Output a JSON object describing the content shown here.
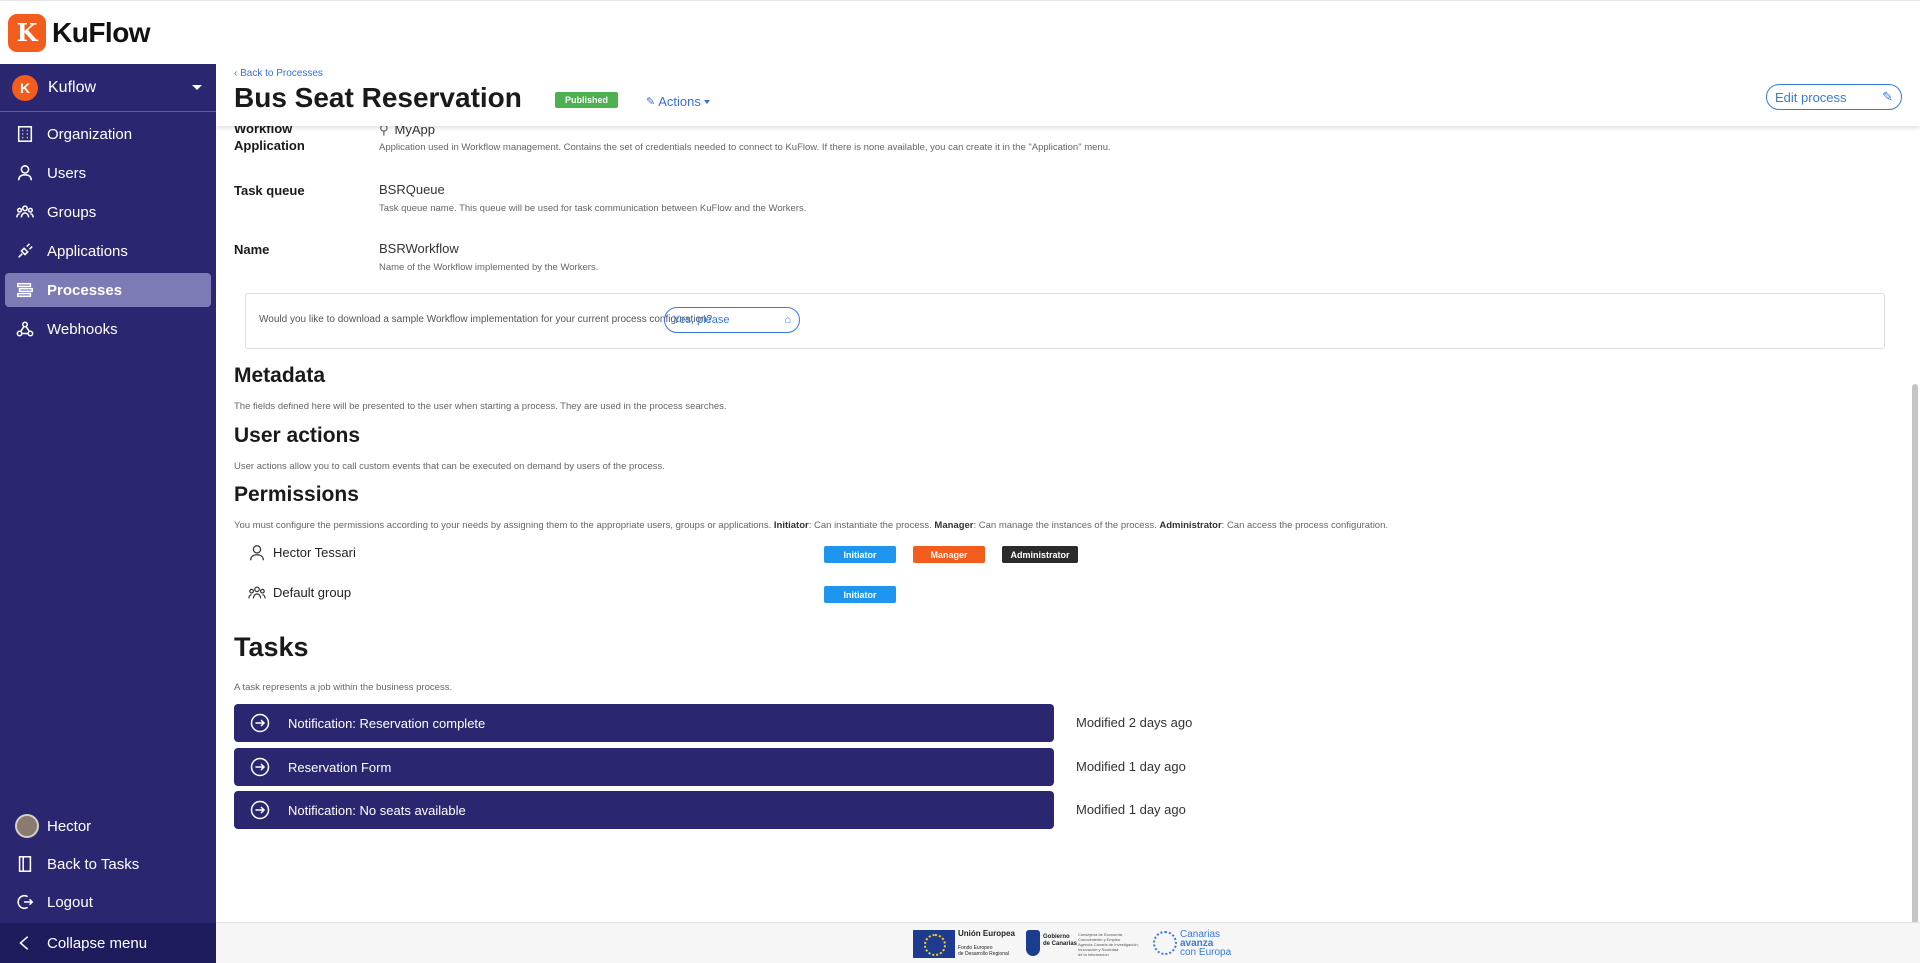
{
  "brand": {
    "name": "KuFlow",
    "logo_letter": "K"
  },
  "sidebar": {
    "org": {
      "name": "Kuflow",
      "avatar_letter": "K"
    },
    "items": [
      {
        "label": "Organization",
        "icon": "building-icon",
        "active": false
      },
      {
        "label": "Users",
        "icon": "user-icon",
        "active": false
      },
      {
        "label": "Groups",
        "icon": "group-icon",
        "active": false
      },
      {
        "label": "Applications",
        "icon": "plug-icon",
        "active": false
      },
      {
        "label": "Processes",
        "icon": "list-icon",
        "active": true
      },
      {
        "label": "Webhooks",
        "icon": "webhook-icon",
        "active": false
      }
    ],
    "user_name": "Hector",
    "back_to_tasks": "Back to Tasks",
    "logout": "Logout",
    "collapse": "Collapse menu"
  },
  "header": {
    "back": "Back to Processes",
    "title": "Bus Seat Reservation",
    "status": "Published",
    "actions": "Actions",
    "edit": "Edit process"
  },
  "workflow": {
    "application": {
      "label_line1": "Workflow",
      "label_line2": "Application",
      "value": "MyApp",
      "help": "Application used in Workflow management. Contains the set of credentials needed to connect to KuFlow. If there is none available, you can create it in the \"Application\" menu."
    },
    "task_queue": {
      "label": "Task queue",
      "value": "BSRQueue",
      "help": "Task queue name. This queue will be used for task communication between KuFlow and the Workers."
    },
    "name": {
      "label": "Name",
      "value": "BSRWorkflow",
      "help": "Name of the Workflow implemented by the Workers."
    },
    "download": {
      "question": "Would you like to download a sample Workflow implementation for your current process configuration?",
      "button": "Yes, please"
    }
  },
  "metadata": {
    "title": "Metadata",
    "desc": "The fields defined here will be presented to the user when starting a process. They are used in the process searches."
  },
  "user_actions": {
    "title": "User actions",
    "desc": "User actions allow you to call custom events that can be executed on demand by users of the process."
  },
  "permissions": {
    "title": "Permissions",
    "desc_intro": "You must configure the permissions according to your needs by assigning them to the appropriate users, groups or applications.",
    "initiator_term": "Initiator",
    "initiator_desc": ": Can instantiate the process.",
    "manager_term": "Manager",
    "manager_desc": ": Can manage the instances of the process.",
    "admin_term": "Administrator",
    "admin_desc": ": Can access the process configuration.",
    "rows": [
      {
        "name": "Hector Tessari",
        "icon": "user-icon",
        "roles": [
          "Initiator",
          "Manager",
          "Administrator"
        ]
      },
      {
        "name": "Default group",
        "icon": "group-icon",
        "roles": [
          "Initiator"
        ]
      }
    ]
  },
  "tasks": {
    "title": "Tasks",
    "desc": "A task represents a job within the business process.",
    "items": [
      {
        "name": "Notification: Reservation complete",
        "modified": "Modified 2 days ago"
      },
      {
        "name": "Reservation Form",
        "modified": "Modified 1 day ago"
      },
      {
        "name": "Notification: No seats available",
        "modified": "Modified 1 day ago"
      }
    ]
  },
  "footer": {
    "eu_title": "Unión Europea",
    "eu_sub1": "Fondo Europeo",
    "eu_sub2": "de Desarrollo Regional",
    "gov_title1": "Gobierno",
    "gov_title2": "de Canarias",
    "gov_sub1": "Consejería de Economía,",
    "gov_sub2": "Conocimiento y Empleo",
    "gov_sub3": "Agencia Canaria de Investigación,",
    "gov_sub4": "Innovación y Sociedad",
    "gov_sub5": "de la Información",
    "can_line1": "Canarias",
    "can_line2": "avanza",
    "can_line3": "con Europa"
  },
  "colors": {
    "sidebar_bg": "#2a2770",
    "accent_orange": "#f25c1d",
    "published_green": "#4caf50",
    "initiator_blue": "#1e96f0",
    "admin_dark": "#2b2b2b",
    "link_blue": "#3a7bd5"
  }
}
